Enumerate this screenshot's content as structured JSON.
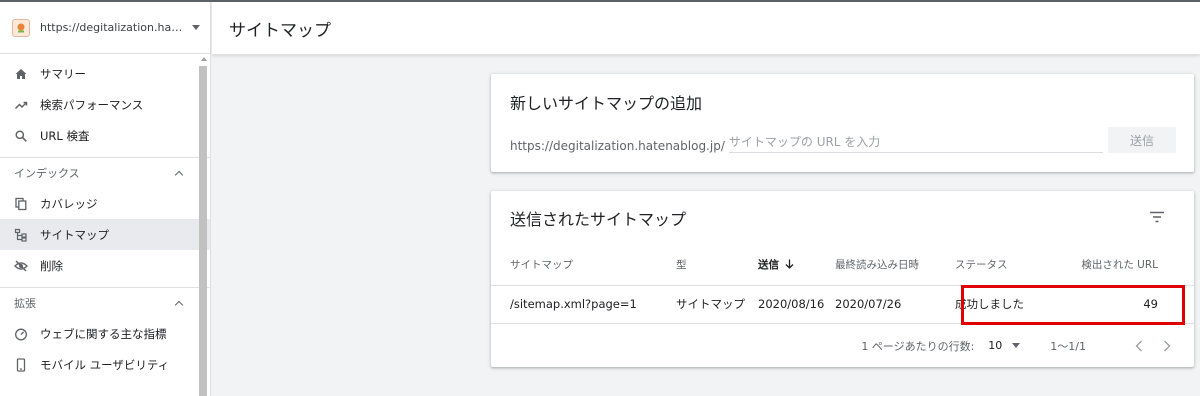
{
  "sidebar": {
    "property_url": "https://degitalization.hatenab...",
    "items_main": [
      {
        "label": "サマリー",
        "icon": "home-icon"
      },
      {
        "label": "検索パフォーマンス",
        "icon": "trending-up-icon"
      },
      {
        "label": "URL 検査",
        "icon": "search-icon"
      }
    ],
    "section_index": {
      "title": "インデックス",
      "items": [
        {
          "label": "カバレッジ",
          "icon": "copy-icon"
        },
        {
          "label": "サイトマップ",
          "icon": "sitemap-icon"
        },
        {
          "label": "削除",
          "icon": "eye-off-icon"
        }
      ]
    },
    "section_ext": {
      "title": "拡張",
      "items": [
        {
          "label": "ウェブに関する主な指標",
          "icon": "speed-icon"
        },
        {
          "label": "モバイル ユーザビリティ",
          "icon": "phone-icon"
        }
      ]
    }
  },
  "header": {
    "title": "サイトマップ"
  },
  "add_card": {
    "title": "新しいサイトマップの追加",
    "url_prefix": "https://degitalization.hatenablog.jp/",
    "input_placeholder": "サイトマップの URL を入力",
    "submit_label": "送信"
  },
  "list_card": {
    "title": "送信されたサイトマップ",
    "columns": [
      "サイトマップ",
      "型",
      "送信",
      "最終読み込み日時",
      "ステータス",
      "検出された URL"
    ],
    "rows": [
      {
        "sitemap": "/sitemap.xml?page=1",
        "type": "サイトマップ",
        "submitted": "2020/08/16",
        "last_read": "2020/07/26",
        "status": "成功しました",
        "urls": "49"
      }
    ],
    "pager": {
      "rows_label": "1 ページあたりの行数:",
      "rows_value": "10",
      "range": "1〜1/1"
    }
  },
  "colors": {
    "status_success": "#188038",
    "highlight_border": "#e00000"
  }
}
